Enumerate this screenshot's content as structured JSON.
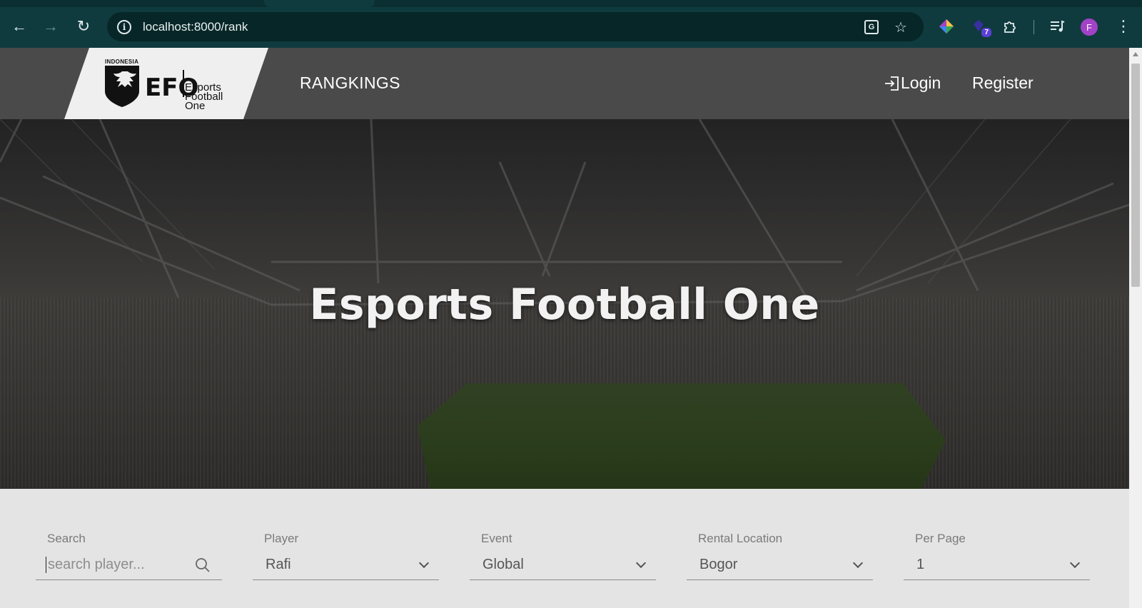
{
  "browser": {
    "url": "localhost:8000/rank",
    "extension_badge": "7",
    "profile_initial": "F",
    "icons": [
      "back-icon",
      "forward-icon",
      "reload-icon",
      "info-icon",
      "translate-icon",
      "star-icon",
      "colorful-extension-icon",
      "diamond-extension-icon",
      "puzzle-icon",
      "media-icon",
      "menu-icon"
    ]
  },
  "site": {
    "logo": {
      "country": "INDONESIA",
      "mark": "EFO",
      "name_line1": "Esports",
      "name_line2": "Football",
      "name_line3": "One"
    },
    "nav": {
      "rankings": "RANGKINGS",
      "login": "Login",
      "register": "Register"
    },
    "hero": {
      "title": "Esports Football One"
    },
    "filters": {
      "search": {
        "label": "Search",
        "placeholder": "search player..."
      },
      "player": {
        "label": "Player",
        "value": "Rafi"
      },
      "event": {
        "label": "Event",
        "value": "Global"
      },
      "rental_location": {
        "label": "Rental Location",
        "value": "Bogor"
      },
      "per_page": {
        "label": "Per Page",
        "value": "1"
      }
    }
  }
}
